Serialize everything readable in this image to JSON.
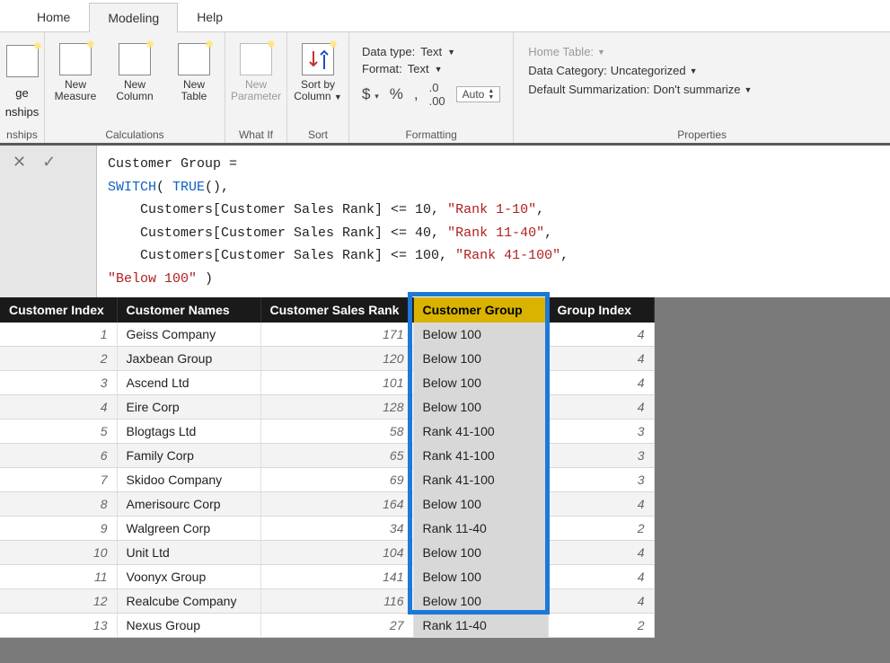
{
  "tabs": {
    "home": "Home",
    "modeling": "Modeling",
    "help": "Help"
  },
  "ribbon": {
    "partial": {
      "line1": "ge",
      "line2": "nships",
      "group_label": "nships"
    },
    "calc": {
      "new_measure_l1": "New",
      "new_measure_l2": "Measure",
      "new_column_l1": "New",
      "new_column_l2": "Column",
      "new_table_l1": "New",
      "new_table_l2": "Table",
      "group_label": "Calculations"
    },
    "whatif": {
      "new_param_l1": "New",
      "new_param_l2": "Parameter",
      "group_label": "What If"
    },
    "sort": {
      "btn_l1": "Sort by",
      "btn_l2": "Column",
      "group_label": "Sort"
    },
    "formatting": {
      "data_type_label": "Data type:",
      "data_type_value": "Text",
      "format_label": "Format:",
      "format_value": "Text",
      "currency": "$",
      "percent": "%",
      "comma": ",",
      "decimals": ".00",
      "auto": "Auto",
      "group_label": "Formatting"
    },
    "properties": {
      "home_table_label": "Home Table:",
      "data_category_label": "Data Category:",
      "data_category_value": "Uncategorized",
      "summarization_label": "Default Summarization:",
      "summarization_value": "Don't summarize",
      "group_label": "Properties"
    }
  },
  "formula": {
    "line1_a": "Customer Group =",
    "line2_a": "SWITCH",
    "line2_b": "( ",
    "line2_c": "TRUE",
    "line2_d": "(),",
    "line3_a": "    Customers[Customer Sales Rank] <= 10, ",
    "line3_b": "\"Rank 1-10\"",
    "line3_c": ",",
    "line4_a": "    Customers[Customer Sales Rank] <= 40, ",
    "line4_b": "\"Rank 11-40\"",
    "line4_c": ",",
    "line5_a": "    Customers[Customer Sales Rank] <= 100, ",
    "line5_b": "\"Rank 41-100\"",
    "line5_c": ",",
    "line6_a": "\"Below 100\"",
    "line6_b": " )"
  },
  "table": {
    "headers": {
      "idx": "Customer Index",
      "name": "Customer Names",
      "rank": "Customer Sales Rank",
      "group": "Customer Group",
      "gidx": "Group Index"
    },
    "rows": [
      {
        "idx": "1",
        "name": "Geiss Company",
        "rank": "171",
        "group": "Below 100",
        "gidx": "4"
      },
      {
        "idx": "2",
        "name": "Jaxbean Group",
        "rank": "120",
        "group": "Below 100",
        "gidx": "4"
      },
      {
        "idx": "3",
        "name": "Ascend Ltd",
        "rank": "101",
        "group": "Below 100",
        "gidx": "4"
      },
      {
        "idx": "4",
        "name": "Eire Corp",
        "rank": "128",
        "group": "Below 100",
        "gidx": "4"
      },
      {
        "idx": "5",
        "name": "Blogtags Ltd",
        "rank": "58",
        "group": "Rank 41-100",
        "gidx": "3"
      },
      {
        "idx": "6",
        "name": "Family Corp",
        "rank": "65",
        "group": "Rank 41-100",
        "gidx": "3"
      },
      {
        "idx": "7",
        "name": "Skidoo Company",
        "rank": "69",
        "group": "Rank 41-100",
        "gidx": "3"
      },
      {
        "idx": "8",
        "name": "Amerisourc Corp",
        "rank": "164",
        "group": "Below 100",
        "gidx": "4"
      },
      {
        "idx": "9",
        "name": "Walgreen Corp",
        "rank": "34",
        "group": "Rank 11-40",
        "gidx": "2"
      },
      {
        "idx": "10",
        "name": "Unit Ltd",
        "rank": "104",
        "group": "Below 100",
        "gidx": "4"
      },
      {
        "idx": "11",
        "name": "Voonyx Group",
        "rank": "141",
        "group": "Below 100",
        "gidx": "4"
      },
      {
        "idx": "12",
        "name": "Realcube Company",
        "rank": "116",
        "group": "Below 100",
        "gidx": "4"
      },
      {
        "idx": "13",
        "name": "Nexus Group",
        "rank": "27",
        "group": "Rank 11-40",
        "gidx": "2"
      }
    ]
  }
}
